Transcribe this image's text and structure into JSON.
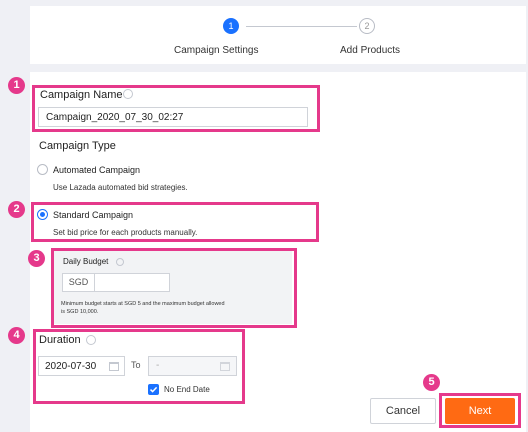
{
  "colors": {
    "accent": "#1a71ff",
    "highlight": "#e5398b",
    "primary_button": "#ff6a13"
  },
  "stepper": {
    "step1": {
      "number": "1",
      "label": "Campaign Settings"
    },
    "step2": {
      "number": "2",
      "label": "Add Products"
    }
  },
  "callouts": [
    "1",
    "2",
    "3",
    "4",
    "5"
  ],
  "campaign_name": {
    "label": "Campaign Name",
    "value": "Campaign_2020_07_30_02:27",
    "help_icon": "info-icon"
  },
  "campaign_type": {
    "label": "Campaign Type",
    "options": [
      {
        "label": "Automated Campaign",
        "description": "Use Lazada automated bid strategies.",
        "selected": false
      },
      {
        "label": "Standard Campaign",
        "description": "Set bid price for each products manually.",
        "selected": true
      }
    ]
  },
  "daily_budget": {
    "label": "Daily Budget",
    "currency": "SGD",
    "value": "",
    "note_line1": "Minimum budget starts at SGD 5 and the maximum budget allowed",
    "note_line2": "is SGD 10,000."
  },
  "duration": {
    "label": "Duration",
    "start_date": "2020-07-30",
    "to_label": "To",
    "end_date": "-",
    "no_end_date_label": "No End Date",
    "no_end_date_checked": true
  },
  "actions": {
    "cancel": "Cancel",
    "next": "Next"
  }
}
